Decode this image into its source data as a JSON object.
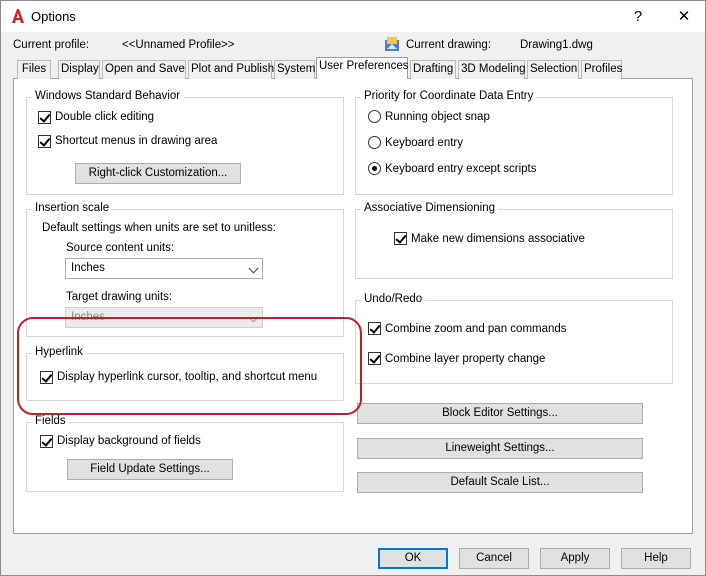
{
  "window": {
    "title": "Options",
    "help_glyph": "?",
    "close_glyph": "✕"
  },
  "header": {
    "current_profile_label": "Current profile:",
    "current_profile_value": "<<Unnamed Profile>>",
    "current_drawing_label": "Current drawing:",
    "current_drawing_value": "Drawing1.dwg"
  },
  "tabs": [
    {
      "label": "Files"
    },
    {
      "label": "Display"
    },
    {
      "label": "Open and Save"
    },
    {
      "label": "Plot and Publish"
    },
    {
      "label": "System"
    },
    {
      "label": "User Preferences",
      "active": true
    },
    {
      "label": "Drafting"
    },
    {
      "label": "3D Modeling"
    },
    {
      "label": "Selection"
    },
    {
      "label": "Profiles"
    }
  ],
  "windows_standard": {
    "title": "Windows Standard Behavior",
    "double_click": "Double click editing",
    "shortcut_menus": "Shortcut menus in drawing area",
    "right_click_button": "Right-click Customization..."
  },
  "insertion_scale": {
    "title": "Insertion scale",
    "description": "Default settings when units are set to unitless:",
    "source_label": "Source content units:",
    "source_value": "Inches",
    "target_label": "Target drawing units:",
    "target_value": "Inches"
  },
  "hyperlink": {
    "title": "Hyperlink",
    "display_option": "Display hyperlink cursor, tooltip, and shortcut menu"
  },
  "fields": {
    "title": "Fields",
    "display_background": "Display background of fields",
    "update_button": "Field Update Settings..."
  },
  "priority": {
    "title": "Priority for Coordinate Data Entry",
    "running_snap": "Running object snap",
    "keyboard_entry": "Keyboard entry",
    "keyboard_except": "Keyboard entry except scripts"
  },
  "assoc_dim": {
    "title": "Associative Dimensioning",
    "make_assoc": "Make new dimensions associative"
  },
  "undo_redo": {
    "title": "Undo/Redo",
    "combine_zoom": "Combine zoom and pan commands",
    "combine_layer": "Combine layer property change"
  },
  "side_buttons": {
    "block_editor": "Block Editor Settings...",
    "lineweight": "Lineweight Settings...",
    "default_scale": "Default Scale List..."
  },
  "footer": {
    "ok": "OK",
    "cancel": "Cancel",
    "apply": "Apply",
    "help": "Help"
  },
  "colors": {
    "highlight": "#c0202a",
    "logo_red": "#d4202c",
    "default_button_border": "#0078d7"
  }
}
